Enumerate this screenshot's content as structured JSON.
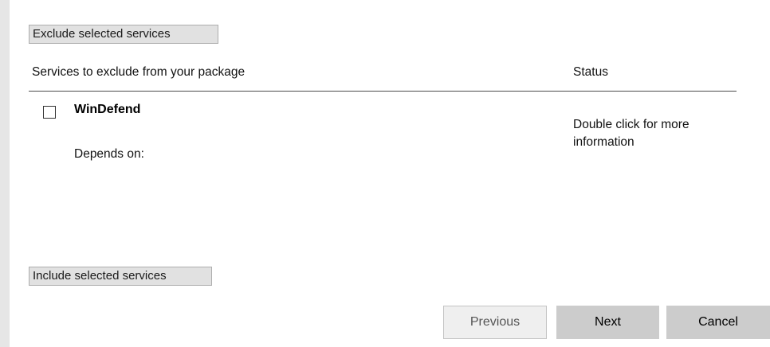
{
  "actions": {
    "exclude_label": "Exclude selected services",
    "include_label": "Include selected services"
  },
  "table": {
    "columns": [
      "Services to exclude from your package",
      "Status"
    ],
    "rows": [
      {
        "checked": false,
        "name": "WinDefend",
        "depends_label": "Depends on:",
        "status": "Double click for more information"
      }
    ]
  },
  "navigation": {
    "previous_label": "Previous",
    "next_label": "Next",
    "cancel_label": "Cancel"
  }
}
